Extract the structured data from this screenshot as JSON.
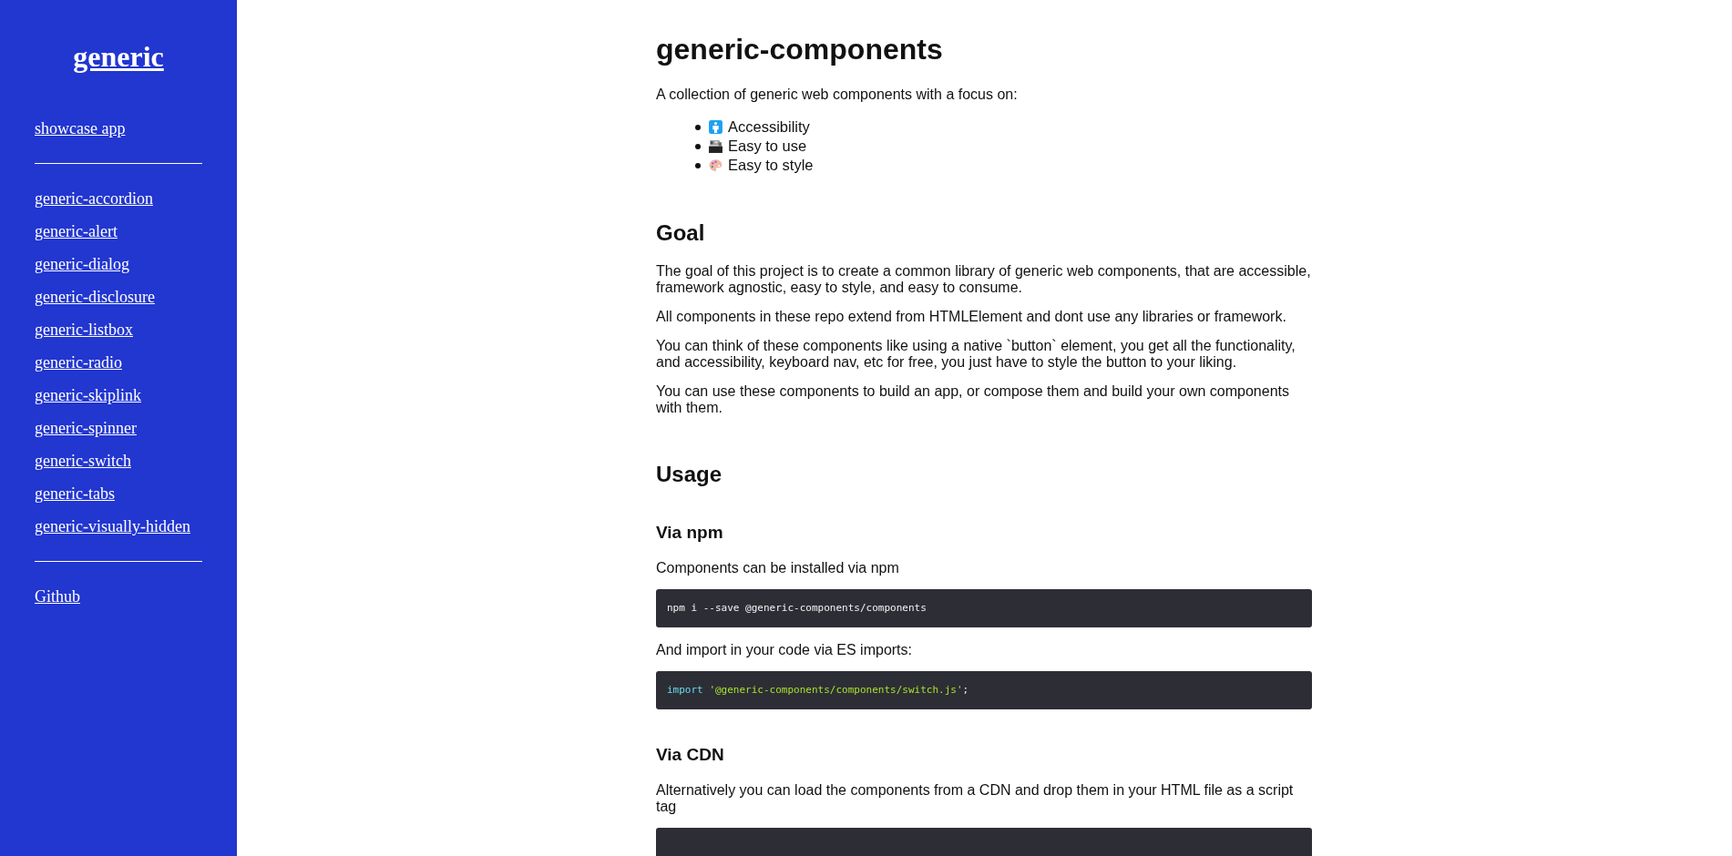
{
  "sidebar": {
    "title": "generic",
    "sections": [
      {
        "links": [
          "showcase app"
        ]
      },
      {
        "links": [
          "generic-accordion",
          "generic-alert",
          "generic-dialog",
          "generic-disclosure",
          "generic-listbox",
          "generic-radio",
          "generic-skiplink",
          "generic-spinner",
          "generic-switch",
          "generic-tabs",
          "generic-visually-hidden"
        ]
      },
      {
        "links": [
          "Github"
        ]
      }
    ]
  },
  "content": {
    "blocks": [
      {
        "kind": "h1",
        "text": "generic-components"
      },
      {
        "kind": "p",
        "text": "A collection of generic web components with a focus on:"
      },
      {
        "kind": "list",
        "items": [
          {
            "text": "Accessibility"
          },
          {
            "text": "Easy to use"
          },
          {
            "text": "Easy to style"
          }
        ]
      },
      {
        "kind": "h2",
        "text": "Goal"
      },
      {
        "kind": "p",
        "text": "The goal of this project is to create a common library of generic web components, that are accessible, framework agnostic, easy to style, and easy to consume."
      },
      {
        "kind": "p",
        "text": "All components in these repo extend from HTMLElement and dont use any libraries or framework."
      },
      {
        "kind": "p",
        "text": "You can think of these components like using a native `button` element, you get all the functionality, and accessibility, keyboard nav, etc for free, you just have to style the button to your liking."
      },
      {
        "kind": "p",
        "text": "You can use these components to build an app, or compose them and build your own components with them."
      },
      {
        "kind": "h2",
        "text": "Usage"
      },
      {
        "kind": "h3",
        "text": "Via npm"
      },
      {
        "kind": "p",
        "text": "Components can be installed via npm"
      },
      {
        "kind": "code",
        "tokens": [
          {
            "kind": "plain",
            "text": "npm i --save @generic-components/components"
          }
        ]
      },
      {
        "kind": "p",
        "text": "And import in your code via ES imports:"
      },
      {
        "kind": "code",
        "tokens": [
          {
            "kind": "keyword",
            "text": "import"
          },
          {
            "kind": "string",
            "text": "'@generic-components/components/switch.js'"
          },
          {
            "kind": "plain",
            "text": ";"
          }
        ]
      },
      {
        "kind": "h3",
        "text": "Via CDN"
      },
      {
        "kind": "p",
        "text": "Alternatively you can load the components from a CDN and drop them in your HTML file as a script tag"
      },
      {
        "kind": "code"
      }
    ]
  }
}
